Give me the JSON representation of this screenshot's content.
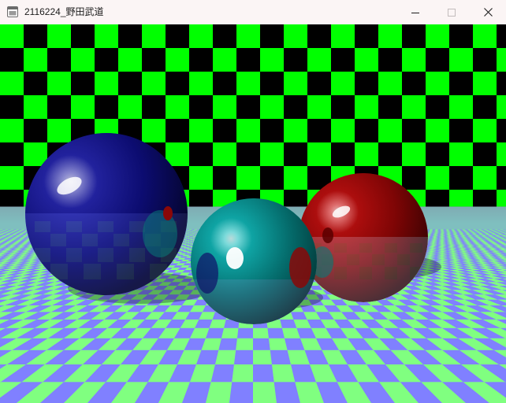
{
  "window": {
    "title": "2116224_野田武道",
    "icon": "app-icon",
    "controls": [
      {
        "name": "minimize",
        "icon": "minimize-icon"
      },
      {
        "name": "maximize",
        "icon": "maximize-icon",
        "enabled": false
      },
      {
        "name": "close",
        "icon": "close-icon"
      }
    ]
  },
  "scene": {
    "type": "ray-traced-render",
    "background_pattern": "checkerboard",
    "background_colors": [
      "#00ff00",
      "#000000"
    ],
    "floor_pattern": "checkerboard",
    "floor_colors": [
      "#80ff80",
      "#8080ff"
    ],
    "spheres": [
      {
        "name": "blue-sphere",
        "color": "#10107a"
      },
      {
        "name": "teal-sphere",
        "color": "#0a8f8f"
      },
      {
        "name": "red-sphere",
        "color": "#8a0808"
      }
    ],
    "colors": {
      "titlebar": "#fbf5f5",
      "title_text": "#1c1c1c"
    }
  }
}
